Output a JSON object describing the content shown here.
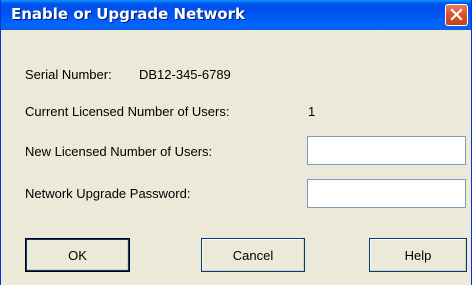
{
  "window": {
    "title": "Enable or Upgrade Network",
    "close_icon": "close-icon"
  },
  "info": {
    "serial_label": "Serial Number:",
    "serial_value": "DB12-345-6789",
    "current_users_label": "Current Licensed Number of Users:",
    "current_users_value": "1"
  },
  "form": {
    "new_users_label": "New Licensed Number of Users:",
    "new_users_value": "",
    "password_label": "Network Upgrade Password:",
    "password_value": ""
  },
  "buttons": {
    "ok_label": "OK",
    "cancel_label": "Cancel",
    "help_label": "Help"
  },
  "colors": {
    "titlebar": "#0053ee",
    "dialog_background": "#ece9d8",
    "close_button": "#d8522b"
  }
}
